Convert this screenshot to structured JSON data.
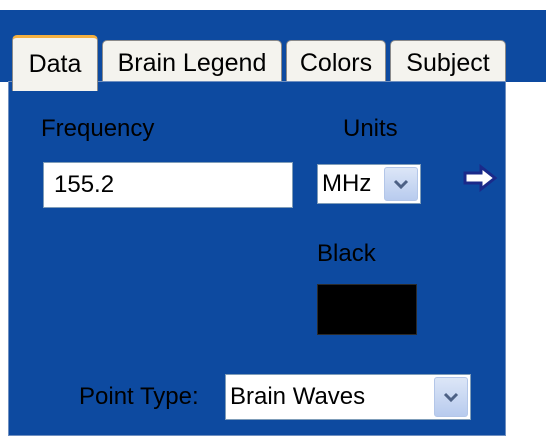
{
  "tabs": [
    {
      "label": "Data",
      "active": true
    },
    {
      "label": "Brain Legend",
      "active": false
    },
    {
      "label": "Colors",
      "active": false
    },
    {
      "label": "Subject",
      "active": false
    }
  ],
  "frequency": {
    "label": "Frequency",
    "value": "155.2"
  },
  "units": {
    "label": "Units",
    "selected": "MHz"
  },
  "color": {
    "label": "Black",
    "swatch_hex": "#000000"
  },
  "point_type": {
    "label": "Point Type:",
    "selected": "Brain Waves"
  },
  "icons": {
    "apply": "right-arrow-icon",
    "dropdown": "chevron-down-icon"
  },
  "colors": {
    "panel_background": "#0d4aa0",
    "tab_background": "#f4f3ee",
    "active_tab_accent": "#f4b040",
    "arrow_fill": "#ffffff",
    "arrow_outline": "#1a2a8a"
  }
}
